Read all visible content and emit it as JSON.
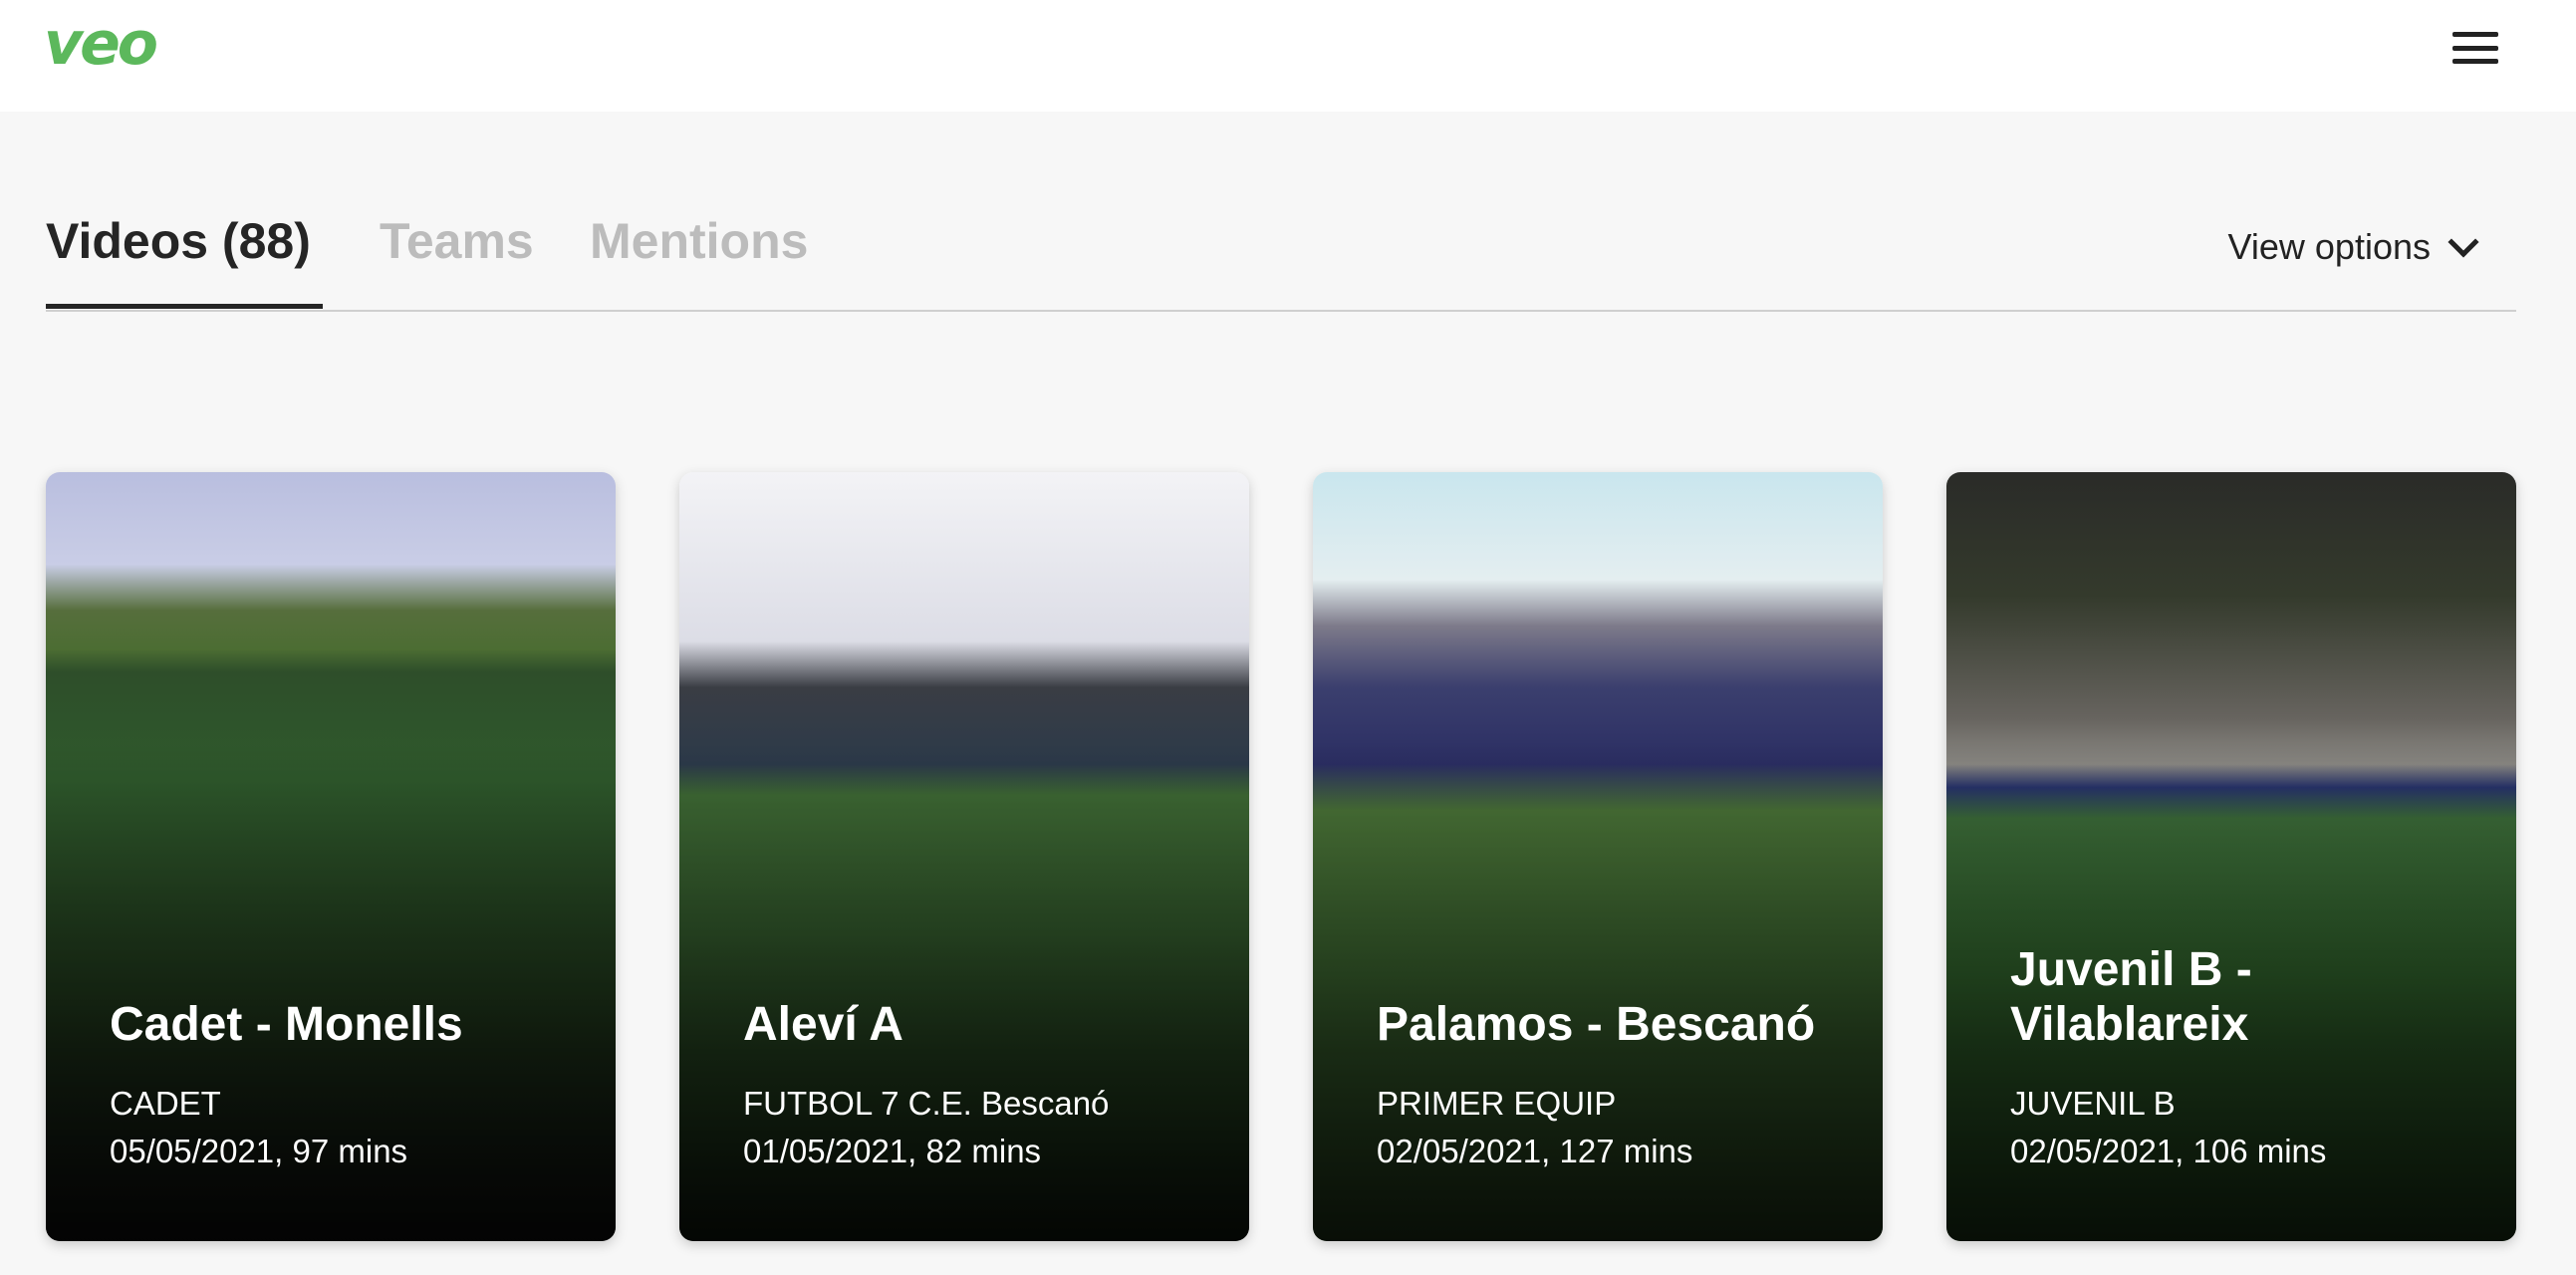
{
  "header": {
    "logo": "veo",
    "menu_icon": "hamburger-menu-icon"
  },
  "tabs": [
    {
      "label": "Videos (88)",
      "active": true
    },
    {
      "label": "Teams",
      "active": false
    },
    {
      "label": "Mentions",
      "active": false
    }
  ],
  "view_options": {
    "label": "View options",
    "icon": "chevron-down-icon"
  },
  "videos": [
    {
      "title": "Cadet - Monells",
      "team": "CADET",
      "meta": "05/05/2021, 97 mins"
    },
    {
      "title": "Aleví A",
      "team": "FUTBOL 7 C.E. Bescanó",
      "meta": "01/05/2021, 82 mins"
    },
    {
      "title": "Palamos - Bescanó",
      "team": "PRIMER EQUIP",
      "meta": "02/05/2021, 127 mins"
    },
    {
      "title": "Juvenil B - Vilablareix",
      "team": "JUVENIL B",
      "meta": "02/05/2021, 106 mins"
    }
  ],
  "colors": {
    "brand": "#5cb85c",
    "active_tab": "#252525",
    "inactive_tab": "#bcbcbc",
    "background": "#f7f7f7"
  }
}
